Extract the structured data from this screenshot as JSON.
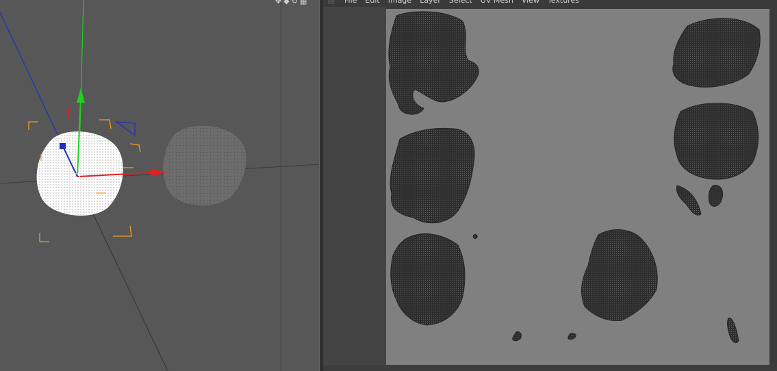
{
  "viewport": {
    "icons": [
      "move-icon",
      "rotate-icon",
      "camera-icon",
      "layout-icon"
    ],
    "icon_glyphs": [
      "✥",
      "◆",
      "↻",
      "▦"
    ]
  },
  "uv_editor": {
    "menu": [
      {
        "id": "file",
        "label": "File"
      },
      {
        "id": "edit",
        "label": "Edit"
      },
      {
        "id": "image",
        "label": "Image"
      },
      {
        "id": "layer",
        "label": "Layer"
      },
      {
        "id": "select",
        "label": "Select"
      },
      {
        "id": "uv-mesh",
        "label": "UV Mesh"
      },
      {
        "id": "view",
        "label": "View"
      },
      {
        "id": "textures",
        "label": "Textures"
      }
    ]
  },
  "colors": {
    "viewport_bg": "#575757",
    "uv_bg": "#808080",
    "axis_x": "#e02020",
    "axis_y": "#20d020",
    "axis_z": "#2030c0",
    "bbox_orange": "#f0a020",
    "uv_island": "#2e2e2e"
  }
}
